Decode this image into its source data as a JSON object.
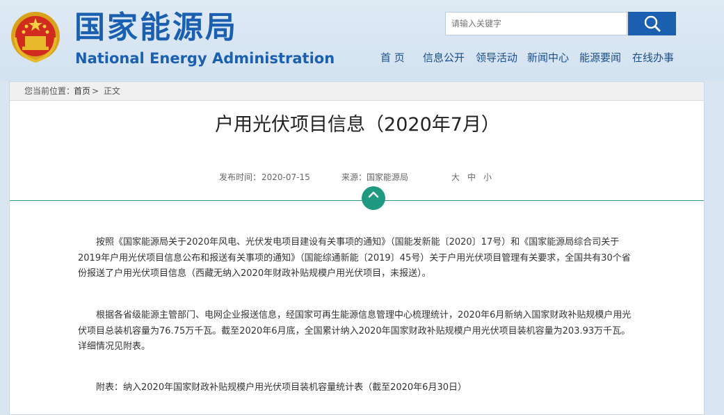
{
  "header": {
    "title_cn": "国家能源局",
    "title_en": "National Energy Administration",
    "emblem_icon": "national-emblem-icon"
  },
  "search": {
    "placeholder": "请输入关键字",
    "button_icon": "search-icon"
  },
  "nav": {
    "items": [
      {
        "label": "首 页"
      },
      {
        "label": "信息公开"
      },
      {
        "label": "领导活动"
      },
      {
        "label": "新闻中心"
      },
      {
        "label": "能源要闻"
      },
      {
        "label": "在线办事"
      }
    ]
  },
  "breadcrumb": {
    "prefix": "您当前位置：",
    "home": "首页",
    "sep": " > ",
    "current": "正文"
  },
  "article": {
    "title": "户用光伏项目信息（2020年7月）",
    "publish_label": "发布时间：",
    "publish_date": "2020-07-15",
    "source_label": "来源：",
    "source": "国家能源局",
    "size_large": "大",
    "size_medium": "中",
    "size_small": "小",
    "paragraphs": [
      "按照《国家能源局关于2020年风电、光伏发电项目建设有关事项的通知》（国能发新能〔2020〕17号）和《国家能源局综合司关于2019年户用光伏项目信息公布和报送有关事项的通知》（国能综通新能〔2019〕45号）关于户用光伏项目管理有关要求，全国共有30个省份报送了户用光伏项目信息（西藏无纳入2020年财政补贴规模户用光伏项目，未报送）。",
      "根据各省级能源主管部门、电网企业报送信息，经国家可再生能源信息管理中心梳理统计，2020年6月新纳入国家财政补贴规模户用光伏项目总装机容量为76.75万千瓦。截至2020年6月底，全国累计纳入2020年国家财政补贴规模户用光伏项目装机容量为203.93万千瓦。详细情况见附表。",
      "附表：纳入2020年国家财政补贴规模户用光伏项目装机容量统计表（截至2020年6月30日）"
    ]
  },
  "colors": {
    "brand_blue": "#1a5fb0",
    "accent_green": "#1f9a80"
  }
}
